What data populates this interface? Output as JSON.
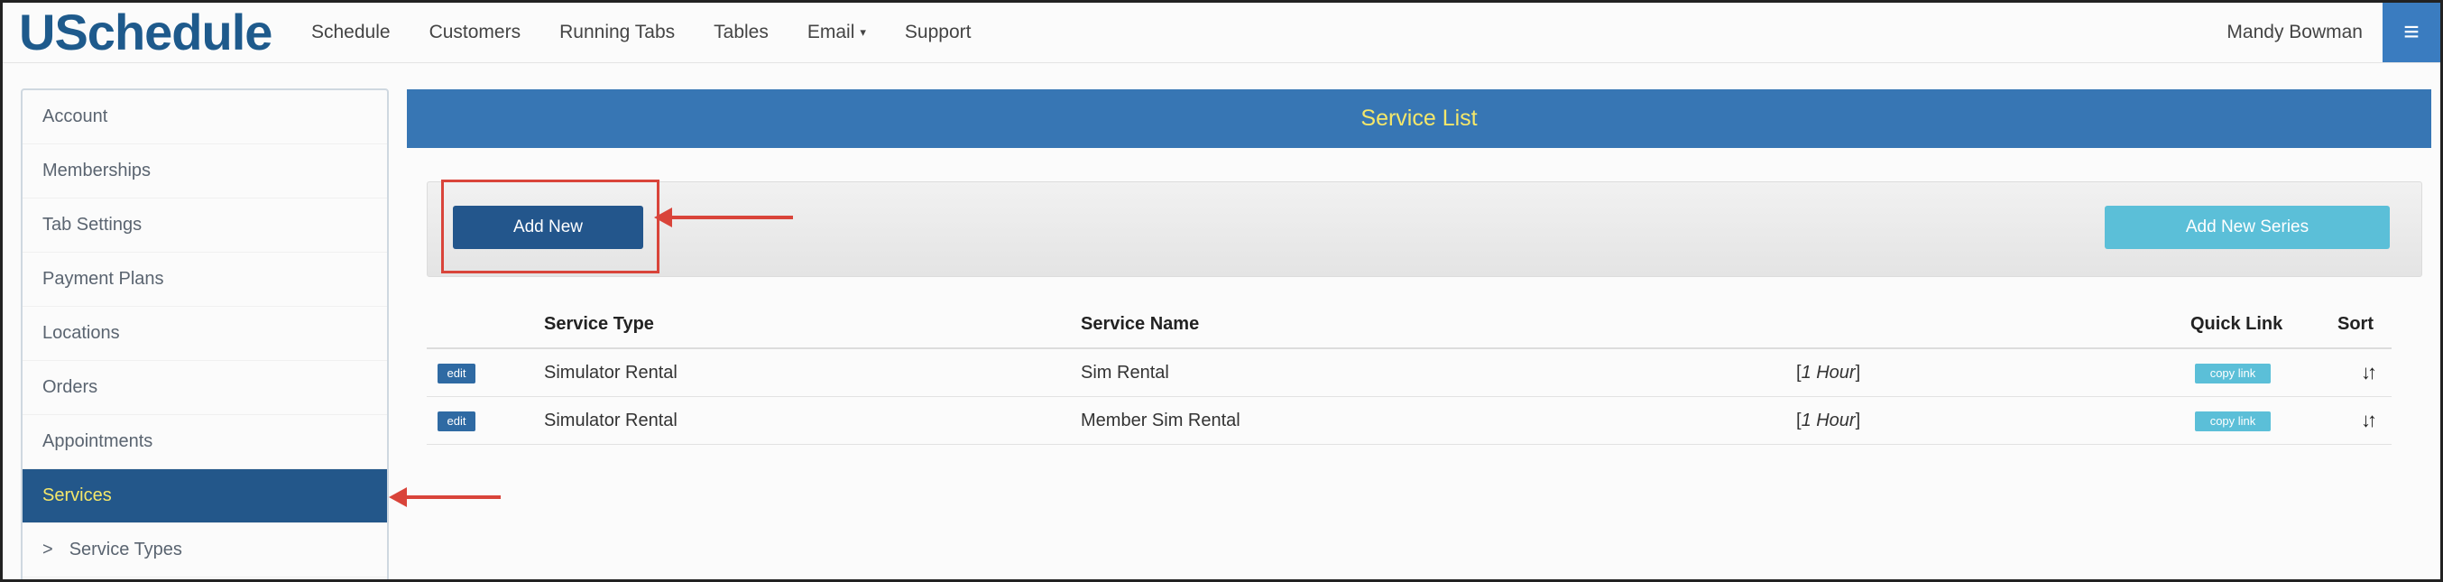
{
  "app": {
    "logo": "USchedule"
  },
  "nav": {
    "items": [
      "Schedule",
      "Customers",
      "Running Tabs",
      "Tables",
      "Email",
      "Support"
    ],
    "email_caret": "▾",
    "user": "Mandy Bowman",
    "menu_icon": "hamburger-icon"
  },
  "sidebar": {
    "items": [
      {
        "label": "Account"
      },
      {
        "label": "Memberships"
      },
      {
        "label": "Tab Settings"
      },
      {
        "label": "Payment Plans"
      },
      {
        "label": "Locations"
      },
      {
        "label": "Orders"
      },
      {
        "label": "Appointments"
      },
      {
        "label": "Services",
        "active": true
      },
      {
        "label": "Service Types",
        "prefix": ">"
      }
    ]
  },
  "main": {
    "title": "Service List",
    "add_new": "Add New",
    "add_new_series": "Add New Series",
    "table": {
      "headers": {
        "service_type": "Service Type",
        "service_name": "Service Name",
        "quick_link": "Quick Link",
        "sort": "Sort"
      },
      "rows": [
        {
          "edit": "edit",
          "service_type": "Simulator Rental",
          "service_name": "Sim Rental",
          "duration_open": "[",
          "duration": "1 Hour",
          "duration_close": "]",
          "copy": "copy link",
          "sort_icon": "↓↑"
        },
        {
          "edit": "edit",
          "service_type": "Simulator Rental",
          "service_name": "Member Sim Rental",
          "duration_open": "[",
          "duration": "1 Hour",
          "duration_close": "]",
          "copy": "copy link",
          "sort_icon": "↓↑"
        }
      ]
    }
  },
  "colors": {
    "brand": "#1e5a8c",
    "header_bar": "#3776b4",
    "header_text": "#f5e76a",
    "primary_button": "#23568c",
    "info_button": "#5bbfd8",
    "annotation": "#d9443a"
  }
}
